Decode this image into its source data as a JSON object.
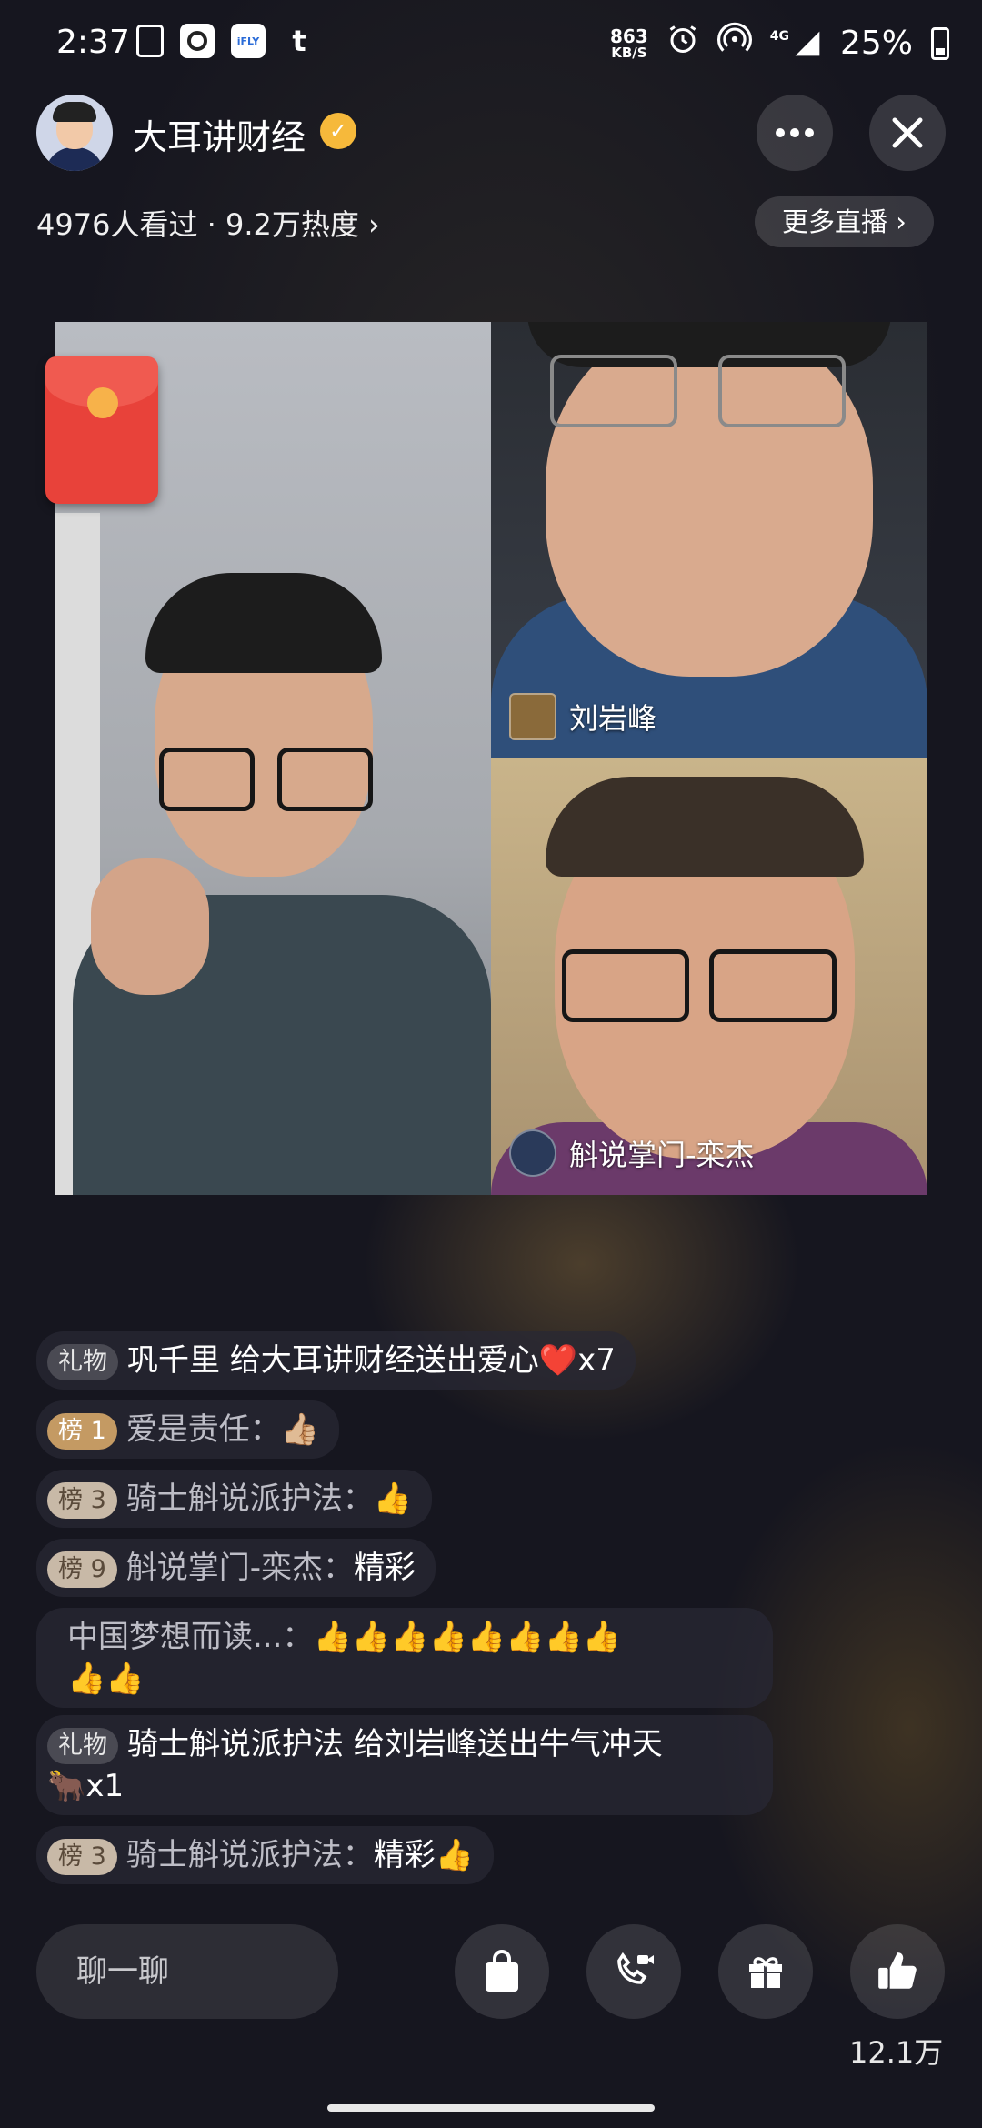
{
  "status_bar": {
    "time": "2:37",
    "app_icons": [
      "clipboard-icon",
      "camera-icon",
      "ifly-icon",
      "tumblr-icon"
    ],
    "netspeed_value": "863",
    "netspeed_unit": "KB/S",
    "network": "4G",
    "battery": "25%"
  },
  "header": {
    "host_name": "大耳讲财经",
    "stats": "4976人看过 · 9.2万热度 ›",
    "more_live": "更多直播 ›"
  },
  "video": {
    "guest1_name": "刘岩峰",
    "guest2_name": "斛说掌门-栾杰"
  },
  "comments": [
    {
      "tag": "礼物",
      "user": "巩千里",
      "text": " 给大耳讲财经送出爱心",
      "emoji": "❤️",
      "suffix": "x7"
    },
    {
      "tag": "榜 1",
      "user": "爱是责任：",
      "text": "",
      "emoji": "👍🏼",
      "suffix": ""
    },
    {
      "tag": "榜 3",
      "user": "骑士斛说派护法：",
      "text": "",
      "emoji": "👍",
      "suffix": ""
    },
    {
      "tag": "榜 9",
      "user": "斛说掌门-栾杰：",
      "text": "精彩",
      "emoji": "",
      "suffix": ""
    },
    {
      "tag": "",
      "user": "中国梦想而读...：",
      "text": "",
      "emoji": "👍👍👍👍👍👍👍👍",
      "emoji2": "👍👍",
      "suffix": ""
    },
    {
      "tag": "礼物",
      "user": "骑士斛说派护法",
      "text": " 给刘岩峰送出牛气冲天",
      "emoji": "🐂",
      "suffix": "x1"
    },
    {
      "tag": "榜 3",
      "user": "骑士斛说派护法：",
      "text": "精彩",
      "emoji": "👍",
      "suffix": ""
    }
  ],
  "bottom_bar": {
    "chat_placeholder": "聊一聊",
    "like_count": "12.1万"
  },
  "colors": {
    "background": "#16161f",
    "verified_badge": "#f6b93b",
    "red_packet": "#e8423a",
    "rank1_tag": "#c49a63"
  }
}
